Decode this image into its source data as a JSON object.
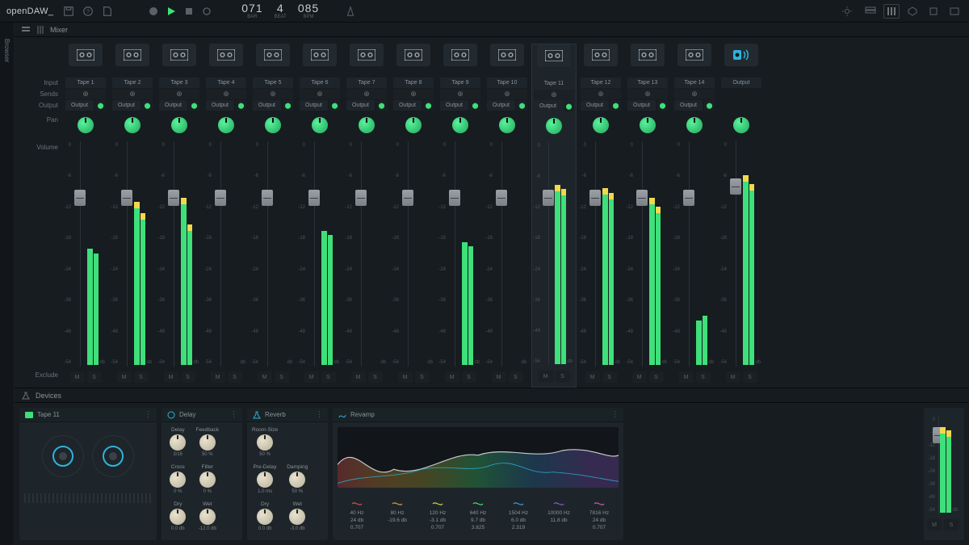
{
  "app_name": "openDAW_",
  "transport": {
    "bar": "071",
    "beat": "4",
    "bpm": "085",
    "bar_label": "BAR",
    "beat_label": "BEAT",
    "bpm_label": "BPM"
  },
  "sidebar": {
    "browser": "Browser"
  },
  "mixer": {
    "title": "Mixer",
    "row_labels": {
      "input": "Input",
      "sends": "Sends",
      "output": "Output",
      "pan": "Pan",
      "volume": "Volume",
      "exclude": "Exclude",
      "db": "db"
    },
    "scale": [
      "0",
      "-6",
      "-12",
      "-18",
      "-24",
      "-36",
      "-48",
      "-54"
    ],
    "output_text": "Output",
    "channels": [
      {
        "name": "Tape 1",
        "fader_pct": 25,
        "meter_l": 52,
        "meter_r": 50,
        "peak": false
      },
      {
        "name": "Tape 2",
        "fader_pct": 25,
        "meter_l": 70,
        "meter_r": 65,
        "peak": true
      },
      {
        "name": "Tape 3",
        "fader_pct": 25,
        "meter_l": 72,
        "meter_r": 60,
        "peak": true
      },
      {
        "name": "Tape 4",
        "fader_pct": 25,
        "meter_l": 0,
        "meter_r": 0,
        "peak": false
      },
      {
        "name": "Tape 5",
        "fader_pct": 25,
        "meter_l": 0,
        "meter_r": 0,
        "peak": false
      },
      {
        "name": "Tape 6",
        "fader_pct": 25,
        "meter_l": 60,
        "meter_r": 58,
        "peak": false
      },
      {
        "name": "Tape 7",
        "fader_pct": 25,
        "meter_l": 0,
        "meter_r": 0,
        "peak": false
      },
      {
        "name": "Tape 8",
        "fader_pct": 25,
        "meter_l": 0,
        "meter_r": 0,
        "peak": false
      },
      {
        "name": "Tape 9",
        "fader_pct": 25,
        "meter_l": 55,
        "meter_r": 53,
        "peak": false
      },
      {
        "name": "Tape 10",
        "fader_pct": 25,
        "meter_l": 0,
        "meter_r": 0,
        "peak": false
      },
      {
        "name": "Tape 11",
        "fader_pct": 25,
        "meter_l": 78,
        "meter_r": 76,
        "peak": true,
        "selected": true
      },
      {
        "name": "Tape 12",
        "fader_pct": 25,
        "meter_l": 76,
        "meter_r": 74,
        "peak": true
      },
      {
        "name": "Tape 13",
        "fader_pct": 25,
        "meter_l": 72,
        "meter_r": 68,
        "peak": true
      },
      {
        "name": "Tape 14",
        "fader_pct": 25,
        "meter_l": 20,
        "meter_r": 22,
        "peak": false
      }
    ],
    "master": {
      "name": "Output",
      "fader_pct": 20,
      "meter_l": 82,
      "meter_r": 78,
      "peak": true
    }
  },
  "devices": {
    "title": "Devices",
    "selected_track": "Tape 11",
    "delay": {
      "title": "Delay",
      "knobs": [
        {
          "label": "Delay",
          "val": "3/16"
        },
        {
          "label": "Feedback",
          "val": "50 %"
        },
        {
          "label": "Cross",
          "val": "0 %"
        },
        {
          "label": "Filter",
          "val": "0 %"
        },
        {
          "label": "Dry",
          "val": "0.0 db"
        },
        {
          "label": "Wet",
          "val": "-12.0 db"
        }
      ]
    },
    "reverb": {
      "title": "Reverb",
      "knobs": [
        {
          "label": "Room-Size",
          "val": "50 %"
        },
        {
          "label": "",
          "val": ""
        },
        {
          "label": "Pre-Delay",
          "val": "1.0 ms"
        },
        {
          "label": "Damping",
          "val": "50 %"
        },
        {
          "label": "Dry",
          "val": "0.0 db"
        },
        {
          "label": "Wet",
          "val": "-3.0 db"
        }
      ]
    },
    "revamp": {
      "title": "Revamp",
      "eq_bands": [
        {
          "freq": "40 Hz",
          "gain": "24 db",
          "q": "0.707",
          "color": "#d94c4c"
        },
        {
          "freq": "80 Hz",
          "gain": "-19.6 db",
          "q": "",
          "color": "#e09a3c"
        },
        {
          "freq": "120 Hz",
          "gain": "-3.1 db",
          "q": "0.707",
          "color": "#e0d23c"
        },
        {
          "freq": "640 Hz",
          "gain": "9.7 db",
          "q": "3.825",
          "color": "#3ee07a"
        },
        {
          "freq": "1504 Hz",
          "gain": "6.0 db",
          "q": "2.319",
          "color": "#3c9ae0"
        },
        {
          "freq": "10000 Hz",
          "gain": "11.8 db",
          "q": "",
          "color": "#8a5ad0"
        },
        {
          "freq": "7816 Hz",
          "gain": "24 db",
          "q": "0.707",
          "color": "#d05aa8"
        }
      ]
    }
  },
  "colors": {
    "accent": "#3ee07a",
    "blue": "#2db3d9"
  }
}
